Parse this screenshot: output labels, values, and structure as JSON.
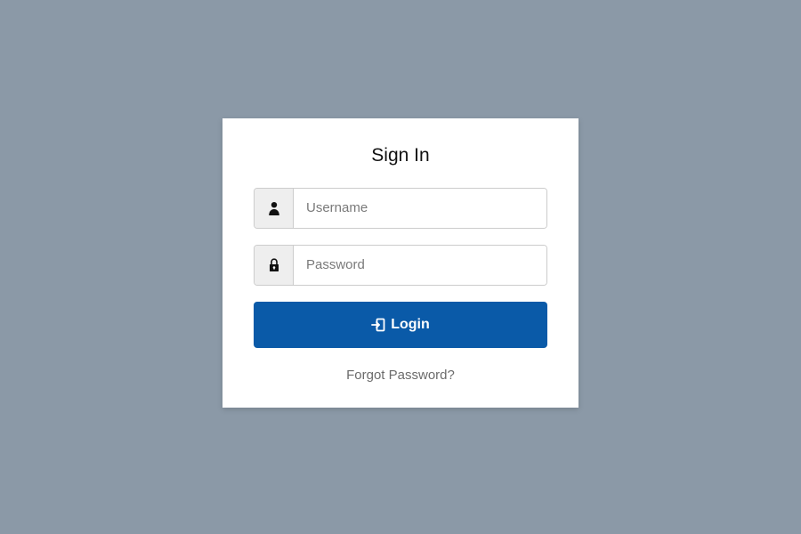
{
  "title": "Sign In",
  "username": {
    "placeholder": "Username",
    "value": ""
  },
  "password": {
    "placeholder": "Password",
    "value": ""
  },
  "login_button": "Login",
  "forgot_link": "Forgot Password?"
}
